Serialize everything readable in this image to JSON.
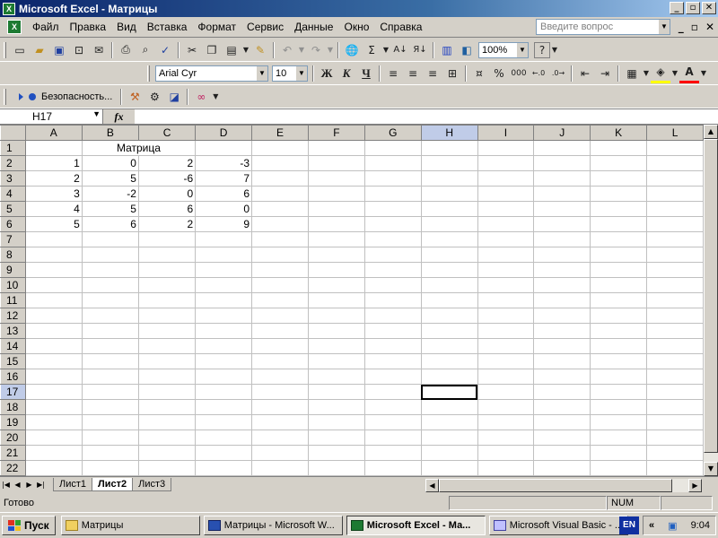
{
  "window": {
    "title": "Microsoft Excel - Матрицы",
    "min_label": "_",
    "max_label": "▫",
    "close_label": "✕"
  },
  "menu": {
    "items": [
      "Файл",
      "Правка",
      "Вид",
      "Вставка",
      "Формат",
      "Сервис",
      "Данные",
      "Окно",
      "Справка"
    ],
    "help_placeholder": "Введите вопрос"
  },
  "toolbar": {
    "zoom": "100%",
    "font_name": "Arial Cyr",
    "font_size": "10",
    "bold_label": "Ж",
    "italic_label": "К",
    "underline_label": "Ч",
    "percent_label": "%",
    "thousands_label": "000",
    "security_label": "Безопасность..."
  },
  "formula_bar": {
    "name_box": "H17",
    "fx_label": "fx",
    "content": ""
  },
  "sheet": {
    "columns": [
      "A",
      "B",
      "C",
      "D",
      "E",
      "F",
      "G",
      "H",
      "I",
      "J",
      "K",
      "L"
    ],
    "active_column": "H",
    "active_row": 17,
    "title_cell": "Матрица",
    "rows": [
      [
        "1",
        "0",
        "2",
        "-3"
      ],
      [
        "2",
        "5",
        "-6",
        "7"
      ],
      [
        "3",
        "-2",
        "0",
        "6"
      ],
      [
        "4",
        "5",
        "6",
        "0"
      ],
      [
        "5",
        "6",
        "2",
        "9"
      ]
    ],
    "row_numbers": [
      "1",
      "2",
      "3",
      "4",
      "5",
      "6",
      "7",
      "8",
      "9",
      "10",
      "11",
      "12",
      "13",
      "14",
      "15",
      "16",
      "17",
      "18",
      "19",
      "20",
      "21",
      "22"
    ]
  },
  "tabs": {
    "sheets": [
      "Лист1",
      "Лист2",
      "Лист3"
    ],
    "active": "Лист2"
  },
  "status": {
    "ready": "Готово",
    "num": "NUM"
  },
  "taskbar": {
    "start": "Пуск",
    "tasks": [
      {
        "label": "Матрицы"
      },
      {
        "label": "Матрицы - Microsoft W..."
      },
      {
        "label": "Microsoft Excel - Ма..."
      },
      {
        "label": "Microsoft Visual Basic - ..."
      }
    ],
    "lang": "EN",
    "clock": "9:04"
  }
}
